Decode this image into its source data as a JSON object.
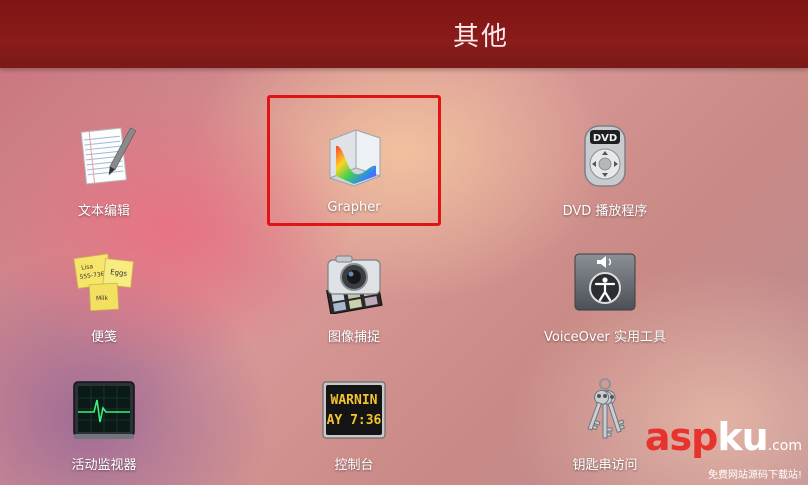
{
  "folder": {
    "title": "其他"
  },
  "apps": [
    {
      "label": "文本编辑",
      "icon": "textedit-icon"
    },
    {
      "label": "Grapher",
      "icon": "grapher-icon",
      "selected": true
    },
    {
      "label": "DVD 播放程序",
      "icon": "dvd-player-icon"
    },
    {
      "label": "便笺",
      "icon": "stickies-icon"
    },
    {
      "label": "图像捕捉",
      "icon": "image-capture-icon"
    },
    {
      "label": "VoiceOver 实用工具",
      "icon": "voiceover-utility-icon"
    },
    {
      "label": "活动监视器",
      "icon": "activity-monitor-icon"
    },
    {
      "label": "控制台",
      "icon": "console-icon"
    },
    {
      "label": "钥匙串访问",
      "icon": "keychain-access-icon"
    }
  ],
  "stickies_notes": {
    "note1": "Lisa",
    "note2": "555-7361",
    "note3": "Eggs",
    "note4": "Milk"
  },
  "console_text": {
    "line1": "WARNIN",
    "line2": "AY 7:36"
  },
  "dvd_badge": "DVD",
  "watermark": {
    "brand_a": "asp",
    "brand_b": "ku",
    "brand_c": ".com",
    "slogan": "免费网站源码下载站!"
  },
  "colors": {
    "titlebar": "#7e1414",
    "selection_border": "#e01414",
    "watermark_accent": "#e8322e"
  }
}
